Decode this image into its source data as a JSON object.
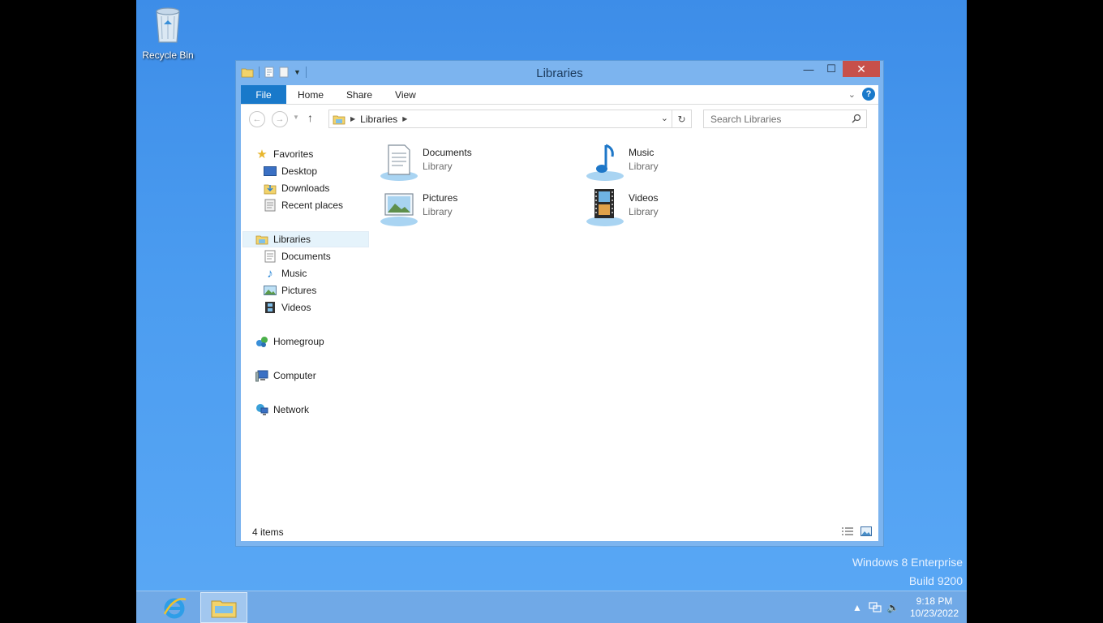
{
  "desktop": {
    "recycle_bin_label": "Recycle Bin",
    "watermark_line1": "Windows 8 Enterprise",
    "watermark_line2": "Build 9200"
  },
  "window": {
    "title": "Libraries",
    "ribbon_tabs": [
      "File",
      "Home",
      "Share",
      "View"
    ],
    "address": {
      "crumb": "Libraries"
    },
    "search_placeholder": "Search Libraries",
    "nav": {
      "favorites": "Favorites",
      "favorites_items": [
        "Desktop",
        "Downloads",
        "Recent places"
      ],
      "libraries": "Libraries",
      "libraries_items": [
        "Documents",
        "Music",
        "Pictures",
        "Videos"
      ],
      "homegroup": "Homegroup",
      "computer": "Computer",
      "network": "Network"
    },
    "items": [
      {
        "name": "Documents",
        "type": "Library",
        "icon": "documents-library-icon"
      },
      {
        "name": "Music",
        "type": "Library",
        "icon": "music-library-icon"
      },
      {
        "name": "Pictures",
        "type": "Library",
        "icon": "pictures-library-icon"
      },
      {
        "name": "Videos",
        "type": "Library",
        "icon": "videos-library-icon"
      }
    ],
    "status_text": "4 items"
  },
  "taskbar": {
    "clock_time": "9:18 PM",
    "clock_date": "10/23/2022"
  },
  "colors": {
    "accent": "#1979ca",
    "close_button": "#c7504a",
    "desktop": "#4b9cf0"
  }
}
